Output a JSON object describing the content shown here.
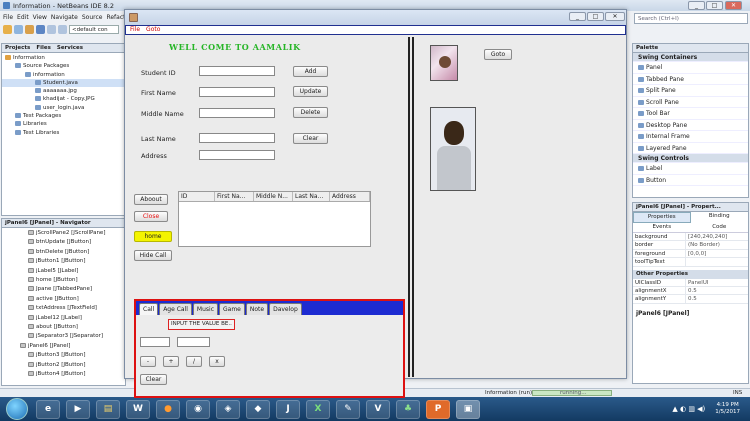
{
  "ide": {
    "title": "Information - NetBeans IDE 8.2",
    "menu": [
      "File",
      "Edit",
      "View",
      "Navigate",
      "Source",
      "Refacto"
    ],
    "config_combo": "<default con",
    "search_placeholder": "Search (Ctrl+I)",
    "win_minimize": "_",
    "win_maximize": "□",
    "win_close": "✕"
  },
  "projects": {
    "tabs": [
      "Projects",
      "Files",
      "Services"
    ],
    "tree": [
      {
        "label": "Information",
        "indent": 0,
        "icon": "cup"
      },
      {
        "label": "Source Packages",
        "indent": 1,
        "icon": "folder"
      },
      {
        "label": "information",
        "indent": 2,
        "icon": "folder"
      },
      {
        "label": "Student.java",
        "indent": 3,
        "icon": "file",
        "selected": true
      },
      {
        "label": "aaaaaaa.jpg",
        "indent": 3,
        "icon": "file"
      },
      {
        "label": "khadijat - Copy.JPG",
        "indent": 3,
        "icon": "file"
      },
      {
        "label": "user_login.java",
        "indent": 3,
        "icon": "file"
      },
      {
        "label": "Test Packages",
        "indent": 1,
        "icon": "folder"
      },
      {
        "label": "Libraries",
        "indent": 1,
        "icon": "folder"
      },
      {
        "label": "Test Libraries",
        "indent": 1,
        "icon": "folder"
      }
    ]
  },
  "navigator": {
    "title": "jPanel6 [JPanel] - Navigator",
    "items": [
      "jScrollPane2 [JScrollPane]",
      "btnUpdate [JButton]",
      "btnDelete [JButton]",
      "jButton1 [JButton]",
      "jLabel5 [JLabel]",
      "home [JButton]",
      "Jpane [JTabbedPane]",
      "active [JButton]",
      "txtAddress [JTextField]",
      "jLabel12 [JLabel]",
      "about [JButton]",
      "jSeparator3 [JSeparator]",
      "jPanel6 [JPanel]",
      "jButton3 [JButton]",
      "jButton2 [JButton]",
      "jButton4 [JButton]"
    ]
  },
  "palette": {
    "title": "Palette",
    "sections": [
      {
        "name": "Swing Containers",
        "items": [
          "Panel",
          "Tabbed Pane",
          "Split Pane",
          "Scroll Pane",
          "Tool Bar",
          "Desktop Pane",
          "Internal Frame",
          "Layered Pane"
        ]
      },
      {
        "name": "Swing Controls",
        "items": [
          "Label",
          "Button"
        ]
      }
    ]
  },
  "properties": {
    "title": "jPanel6 [JPanel] - Propert...",
    "tabs": [
      "Properties",
      "Binding",
      "Events",
      "Code"
    ],
    "rows": [
      {
        "k": "background",
        "v": "[240,240,240]"
      },
      {
        "k": "border",
        "v": "(No Border)"
      },
      {
        "k": "foreground",
        "v": "[0,0,0]"
      },
      {
        "k": "toolTipText",
        "v": ""
      }
    ],
    "other_header": "Other Properties",
    "other_rows": [
      {
        "k": "UIClassID",
        "v": "PanelUI"
      },
      {
        "k": "alignmentX",
        "v": "0.5"
      },
      {
        "k": "alignmentY",
        "v": "0.5"
      }
    ],
    "footer": "jPanel6 [JPanel]"
  },
  "status": {
    "task": "Information (run)",
    "running": "running...",
    "mode": "INS"
  },
  "taskbar": {
    "time": "4:19 PM",
    "date": "1/5/2017"
  },
  "app": {
    "menu": [
      "File",
      "Goto"
    ],
    "heading": "WELL COME TO AAMALIK",
    "labels": {
      "student_id": "Student ID",
      "first_name": "First Name",
      "middle_name": "Middle Name",
      "last_name": "Last Name",
      "address": "Address"
    },
    "buttons": {
      "add": "Add",
      "update": "Update",
      "delete": "Delete",
      "clear": "Clear",
      "about": "Aboout",
      "close": "Close",
      "home": "home",
      "hide_call": "Hide Call",
      "goto": "Goto"
    },
    "table_headers": [
      "ID",
      "First Na...",
      "Middle N...",
      "Last Na...",
      "Address"
    ],
    "tabs": [
      "Call",
      "Age Call",
      "Music",
      "Game",
      "Note",
      "Davelop"
    ],
    "tab_prompt": "INPUT THE VALUE BE..",
    "calc_buttons": [
      "-",
      "+",
      "/",
      "x"
    ],
    "calc_clear": "Clear"
  },
  "colors": {
    "heading": "#26b526",
    "tab_strip": "#1d2bd1",
    "tab_border": "#dd1111",
    "home": "#f4f400",
    "close_text": "#e81010"
  }
}
